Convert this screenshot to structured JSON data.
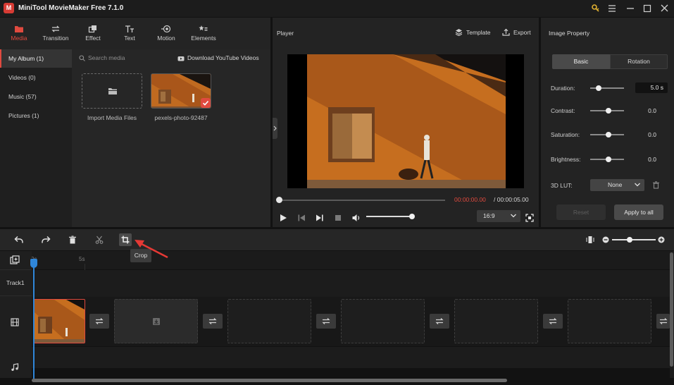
{
  "window": {
    "title": "MiniTool MovieMaker Free 7.1.0",
    "logo_letter": "M",
    "controls": [
      "key-icon",
      "menu-icon",
      "minimize-icon",
      "maximize-icon",
      "close-icon"
    ]
  },
  "top_tabs": [
    {
      "label": "Media",
      "icon": "folder-icon",
      "active": true
    },
    {
      "label": "Transition",
      "icon": "transition-icon"
    },
    {
      "label": "Effect",
      "icon": "effect-icon"
    },
    {
      "label": "Text",
      "icon": "text-icon"
    },
    {
      "label": "Motion",
      "icon": "motion-icon"
    },
    {
      "label": "Elements",
      "icon": "elements-icon"
    }
  ],
  "sidebar": {
    "items": [
      {
        "label": "My Album (1)",
        "active": true
      },
      {
        "label": "Videos (0)"
      },
      {
        "label": "Music (57)"
      },
      {
        "label": "Pictures (1)"
      }
    ]
  },
  "media": {
    "search_placeholder": "Search media",
    "download_label": "Download YouTube Videos",
    "import_label": "Import Media Files",
    "clip_name": "pexels-photo-92487"
  },
  "player": {
    "title": "Player",
    "template_label": "Template",
    "export_label": "Export",
    "time_current": "00:00:00.00",
    "time_total": "/ 00:00:05.00",
    "aspect_ratio": "16:9",
    "volume_level": 0.95
  },
  "properties": {
    "title": "Image Property",
    "tabs": [
      "Basic",
      "Rotation"
    ],
    "duration_label": "Duration:",
    "duration_value": "5.0 s",
    "contrast_label": "Contrast:",
    "contrast_value": "0.0",
    "saturation_label": "Saturation:",
    "saturation_value": "0.0",
    "brightness_label": "Brightness:",
    "brightness_value": "0.0",
    "lut_label": "3D LUT:",
    "lut_value": "None",
    "reset_label": "Reset",
    "apply_label": "Apply to all"
  },
  "timeline": {
    "tooltip": "Crop",
    "ruler_ticks": [
      "0s",
      "5s"
    ],
    "track_label": "Track1"
  },
  "colors": {
    "accent": "#e04a3f",
    "playhead": "#2f86d9"
  }
}
